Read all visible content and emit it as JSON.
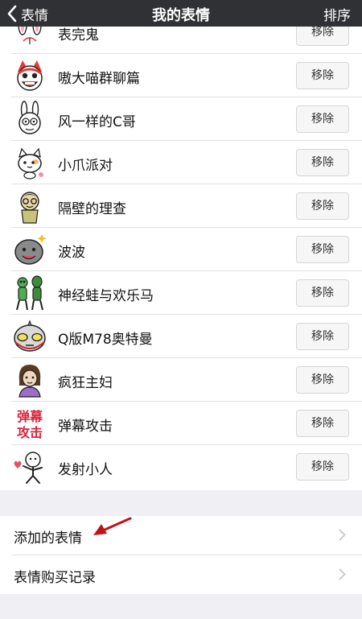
{
  "nav": {
    "back_label": "表情",
    "title": "我的表情",
    "sort_label": "排序"
  },
  "stickers": [
    {
      "name": "表完鬼",
      "action": "移除",
      "icon": "bunny-sticker-icon"
    },
    {
      "name": "嗷大喵群聊篇",
      "action": "移除",
      "icon": "cat-sticker-icon"
    },
    {
      "name": "风一样的C哥",
      "action": "移除",
      "icon": "rabbit-sticker-icon"
    },
    {
      "name": "小爪派对",
      "action": "移除",
      "icon": "kitten-sticker-icon"
    },
    {
      "name": "隔壁的理查",
      "action": "移除",
      "icon": "richard-sticker-icon"
    },
    {
      "name": "波波",
      "action": "移除",
      "icon": "bobo-sticker-icon"
    },
    {
      "name": "神经蛙与欢乐马",
      "action": "移除",
      "icon": "frog-sticker-icon"
    },
    {
      "name": "Q版M78奥特曼",
      "action": "移除",
      "icon": "ultraman-sticker-icon"
    },
    {
      "name": "疯狂主妇",
      "action": "移除",
      "icon": "housewife-sticker-icon"
    },
    {
      "name": "弹幕攻击",
      "action": "移除",
      "icon": "danmaku-sticker-icon",
      "icon_text": [
        "弹幕",
        "攻击"
      ]
    },
    {
      "name": "发射小人",
      "action": "移除",
      "icon": "stickman-sticker-icon"
    }
  ],
  "menu": {
    "added": "添加的表情",
    "purchases": "表情购买记录"
  },
  "colors": {
    "navbar": "#2f3134",
    "background": "#efeff4",
    "arrow": "#c0121b",
    "danmaku_icon": "#d9233d"
  }
}
